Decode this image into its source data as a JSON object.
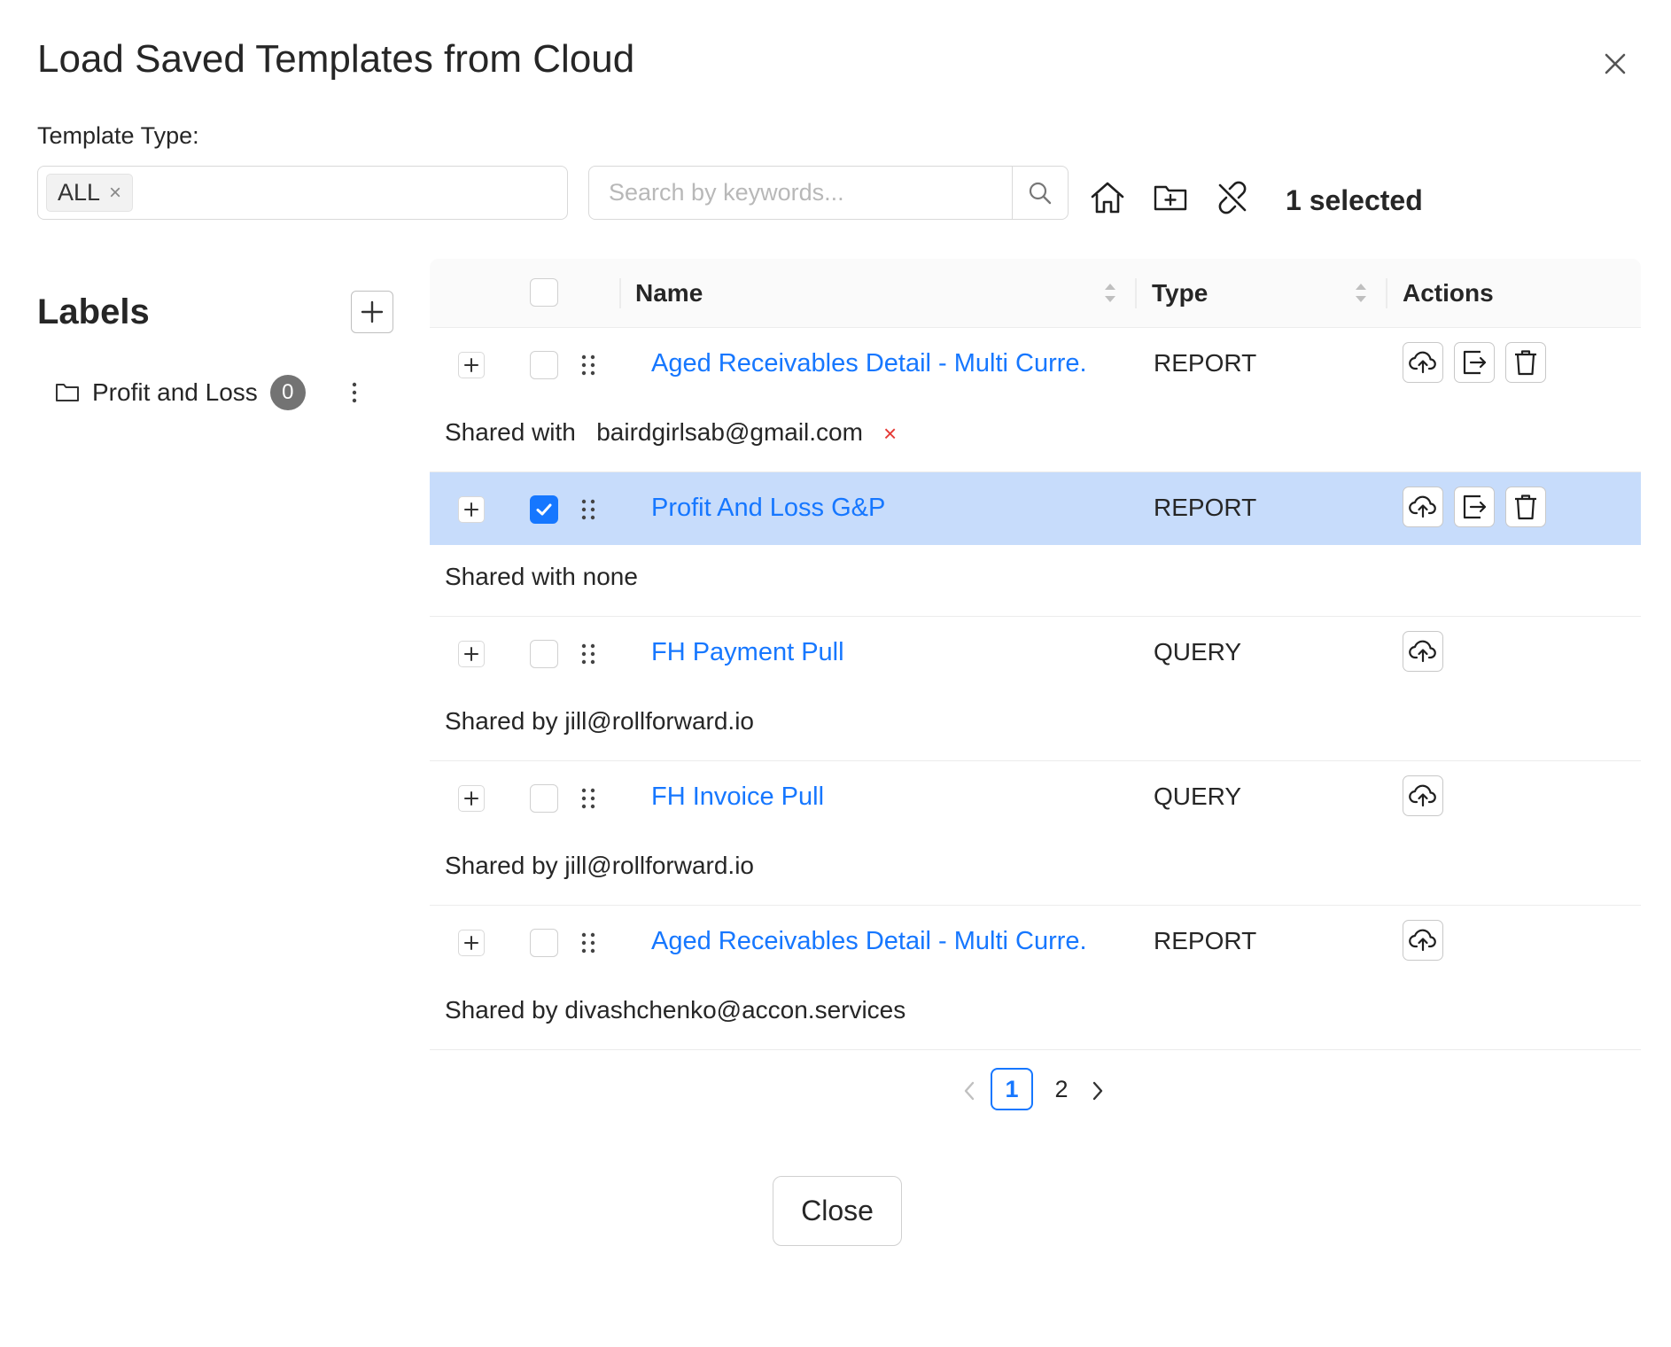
{
  "dialog": {
    "title": "Load Saved Templates from Cloud"
  },
  "filters": {
    "template_type_label": "Template Type:",
    "template_type_tag": "ALL",
    "tag_remove": "×",
    "search_placeholder": "Search by keywords...",
    "selected_count": "1 selected"
  },
  "labels": {
    "title": "Labels",
    "items": [
      {
        "name": "Profit and Loss",
        "count": "0"
      }
    ]
  },
  "table": {
    "columns": [
      "Name",
      "Type",
      "Actions"
    ],
    "rows": [
      {
        "name": "Aged Receivables Detail - Multi Curre.",
        "type": "REPORT",
        "shared": "Shared with   bairdgirlsab@gmail.com",
        "shared_remove": "×",
        "selected": false,
        "actions": [
          "cloud-upload",
          "export",
          "delete"
        ]
      },
      {
        "name": "Profit And Loss G&P",
        "type": "REPORT",
        "shared": "Shared with none",
        "selected": true,
        "actions": [
          "cloud-upload",
          "export",
          "delete"
        ]
      },
      {
        "name": "FH Payment Pull",
        "type": "QUERY",
        "shared": "Shared by jill@rollforward.io",
        "selected": false,
        "actions": [
          "cloud-upload"
        ]
      },
      {
        "name": "FH Invoice Pull",
        "type": "QUERY",
        "shared": "Shared by jill@rollforward.io",
        "selected": false,
        "actions": [
          "cloud-upload"
        ]
      },
      {
        "name": "Aged Receivables Detail - Multi Curre.",
        "type": "REPORT",
        "shared": "Shared by divashchenko@accon.services",
        "selected": false,
        "actions": [
          "cloud-upload"
        ]
      }
    ]
  },
  "pagination": {
    "current": "1",
    "pages": [
      "1",
      "2"
    ]
  },
  "footer": {
    "close_label": "Close"
  },
  "colors": {
    "accent": "#1677ff",
    "selected_row": "#c7dcfb",
    "remove": "#e53935"
  }
}
